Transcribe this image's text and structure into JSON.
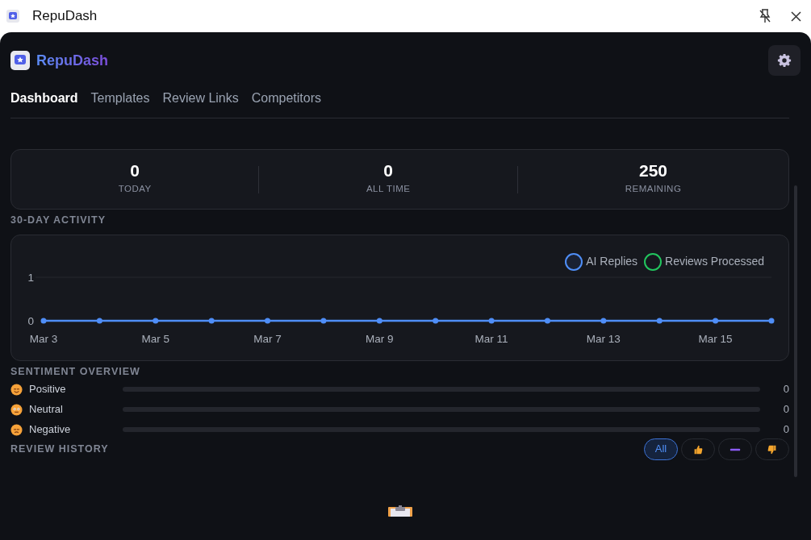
{
  "window": {
    "title": "RepuDash"
  },
  "header": {
    "brand": "RepuDash"
  },
  "tabs": [
    {
      "label": "Dashboard",
      "selected": true
    },
    {
      "label": "Templates",
      "selected": false
    },
    {
      "label": "Review Links",
      "selected": false
    },
    {
      "label": "Competitors",
      "selected": false
    }
  ],
  "stats": [
    {
      "value": "0",
      "label": "TODAY"
    },
    {
      "value": "0",
      "label": "ALL TIME"
    },
    {
      "value": "250",
      "label": "REMAINING"
    }
  ],
  "activity": {
    "heading": "30-DAY ACTIVITY",
    "chart_data": {
      "type": "line",
      "categories": [
        "Mar 3",
        null,
        "Mar 5",
        null,
        "Mar 7",
        null,
        "Mar 9",
        null,
        "Mar 11",
        null,
        "Mar 13",
        null,
        "Mar 15",
        null
      ],
      "series": [
        {
          "name": "AI Replies",
          "color": "#4f8ef7",
          "marker": "circle",
          "values": [
            0,
            0,
            0,
            0,
            0,
            0,
            0,
            0,
            0,
            0,
            0,
            0,
            0,
            0
          ]
        },
        {
          "name": "Reviews Processed",
          "color": "#22c55e",
          "marker": "circle",
          "values": [
            null,
            null,
            null,
            null,
            null,
            null,
            null,
            null,
            null,
            null,
            null,
            null,
            null,
            null
          ]
        }
      ],
      "legend": "top-right",
      "ylim": [
        0,
        1
      ],
      "yticks": [
        0,
        1
      ]
    }
  },
  "sentiment": {
    "heading": "SENTIMENT OVERVIEW",
    "rows": [
      {
        "kind": "positive",
        "label": "Positive",
        "level": 0,
        "count": "0"
      },
      {
        "kind": "neutral",
        "label": "Neutral",
        "level": 0,
        "count": "0"
      },
      {
        "kind": "negative",
        "label": "Negative",
        "level": 0,
        "count": "0"
      }
    ]
  },
  "history": {
    "heading": "REVIEW HISTORY",
    "filters": [
      {
        "kind": "all",
        "label": "All",
        "selected": true
      },
      {
        "kind": "positive",
        "selected": false
      },
      {
        "kind": "neutral",
        "selected": false
      },
      {
        "kind": "negative",
        "selected": false
      }
    ]
  }
}
